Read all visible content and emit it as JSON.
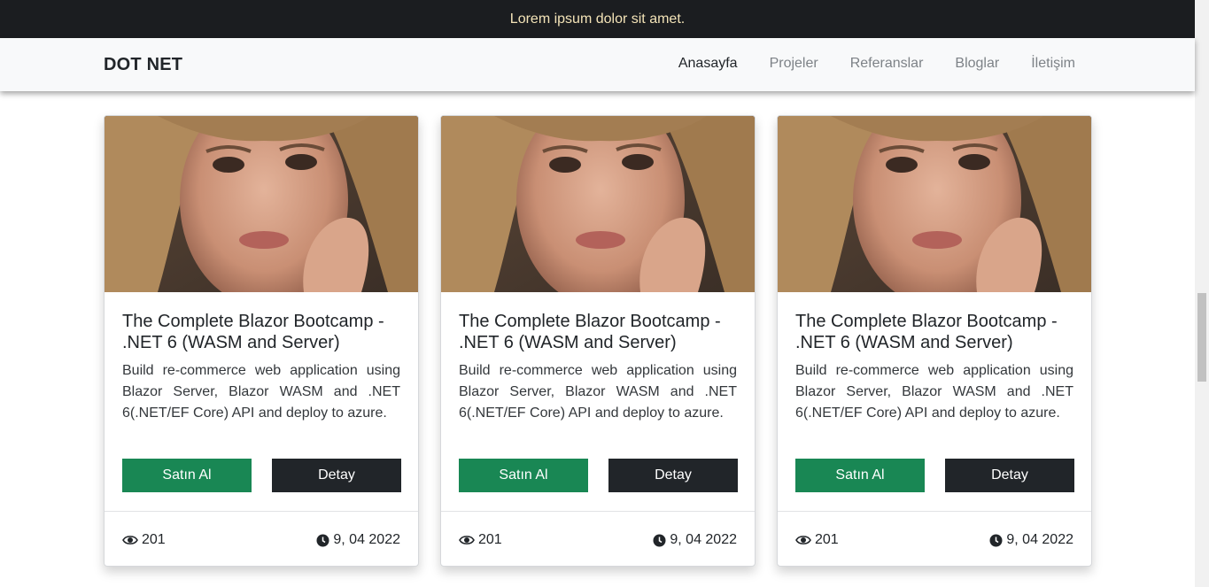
{
  "topbar": {
    "message": "Lorem ipsum dolor sit amet."
  },
  "navbar": {
    "brand": "DOT NET",
    "links": [
      {
        "label": "Anasayfa"
      },
      {
        "label": "Projeler"
      },
      {
        "label": "Referanslar"
      },
      {
        "label": "Bloglar"
      },
      {
        "label": "İletişim"
      }
    ]
  },
  "cards": [
    {
      "title": "The Complete Blazor Bootcamp - .NET 6 (WASM and Server)",
      "description": "Build re-commerce web application using Blazor Server, Blazor WASM and .NET 6(.NET/EF Core) API and deploy to azure.",
      "buy_label": "Satın Al",
      "detail_label": "Detay",
      "views": "201",
      "date": "9, 04 2022"
    },
    {
      "title": "The Complete Blazor Bootcamp - .NET 6 (WASM and Server)",
      "description": "Build re-commerce web application using Blazor Server, Blazor WASM and .NET 6(.NET/EF Core) API and deploy to azure.",
      "buy_label": "Satın Al",
      "detail_label": "Detay",
      "views": "201",
      "date": "9, 04 2022"
    },
    {
      "title": "The Complete Blazor Bootcamp - .NET 6 (WASM and Server)",
      "description": "Build re-commerce web application using Blazor Server, Blazor WASM and .NET 6(.NET/EF Core) API and deploy to azure.",
      "buy_label": "Satın Al",
      "detail_label": "Detay",
      "views": "201",
      "date": "9, 04 2022"
    }
  ],
  "icons": {
    "views": "eye-icon",
    "date": "clock-icon"
  },
  "colors": {
    "buy_button": "#198754",
    "detail_button": "#212529",
    "topbar_bg": "#1b1d20",
    "topbar_text": "#f3e3b7"
  }
}
